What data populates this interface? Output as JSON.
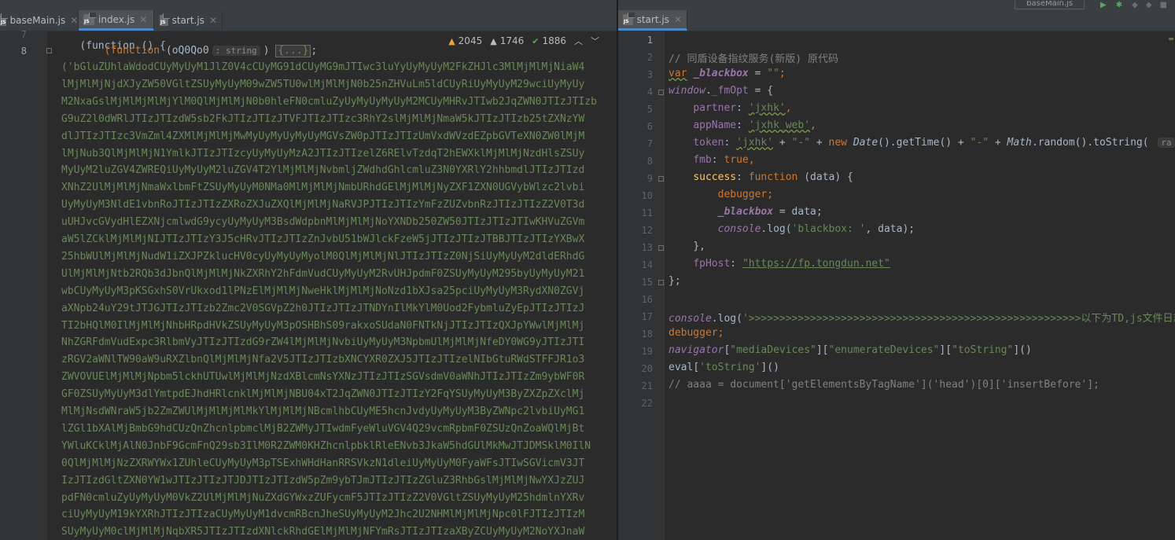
{
  "left_tabs": [
    {
      "label": "baseMain.js"
    },
    {
      "label": "index.js"
    },
    {
      "label": "start.js"
    }
  ],
  "right_tabs": [
    {
      "label": "start.js"
    }
  ],
  "toolbar": {
    "run_config": "baseMain.js"
  },
  "problems": {
    "errors": "2045",
    "warnings": "1746",
    "ok": "1886"
  },
  "left_editor": {
    "line_numbers": [
      "7",
      "8"
    ],
    "line7": "(function () {",
    "line8_keyword": "(function",
    "line8_param": "oQ0Qo0",
    "line8_hint": ": string",
    "line8_close": ")",
    "line8_fold": "{...}",
    "line8_tail": ";",
    "string_lines": [
      "('bGluZUhlaWdodCUyMyUyM1JlZ0V4cCUyMG91dCUyMG9mJTIwc3luYyUyMyUyM2FkZHJlc3MlMjMlMjNiaW4",
      "lMjMlMjNjdXJyZW50VGltZSUyMyUyM09wZW5TU0wlMjMlMjN0b25nZHVuLm5ldCUyRiUyMyUyM29wciUyMyUy",
      "M2NxaGslMjMlMjMlMjYlM0QlMjMlMjN0b0hleFN0cmluZyUyMyUyMyUyM2MCUyMHRvJTIwb2JqZWN0JTIzJTIzb",
      "G9uZ2l0dWRlJTIzJTIzdW5sb2FkJTIzJTIzJTVFJTIzJTIzc3RhY2slMjMlMjNmaW5kJTIzJTIzb25tZXNzYW",
      "dlJTIzJTIzc3VmZml4ZXMlMjMlMjMwMyUyMyUyMyUyMGVsZW0pJTIzJTIzUmVxdWVzdEZpbGVTeXN0ZW0lMjM",
      "lMjNub3QlMjMlMjN1YmlkJTIzJTIzcyUyMyUyMzA2JTIzJTIzelZ6RElvTzdqT2hEWXklMjMlMjNzdHlsZSUy",
      "MyUyM2luZGV4ZWREQiUyMyUyM2luZGV4T2YlMjMlMjNvbmljZWdhdGhlcmluZ3N0YXRlY2hhbmdlJTIzJTIzd",
      "XNhZ2UlMjMlMjNmaWxlbmFtZSUyMyUyM0NMa0MlMjMlMjNmbURhdGElMjMlMjNyZXF1ZXN0UGVybWlzc2lvbi",
      "UyMyUyM3NldE1vbnRoJTIzJTIzZXRoZXJuZXQlMjMlMjNaRVJPJTIzJTIzYmFzZUZvbnRzJTIzJTIzZ2V0T3d",
      "uUHJvcGVydHlEZXNjcmlwdG9ycyUyMyUyM3BsdWdpbnMlMjMlMjNoYXNDb250ZW50JTIzJTIzJTIwKHVuZGVm",
      "aW5lZCklMjMlMjNIJTIzJTIzY3J5cHRvJTIzJTIzZnJvbU51bWJlckFzeW5jJTIzJTIzJTBBJTIzJTIzYXBwX",
      "25hbWUlMjMlMjNudW1iZXJPZklucHV0cyUyMyUyMyolM0QlMjMlMjNlJTIzJTIzZ0NjSiUyMyUyM2dldERhdG",
      "UlMjMlMjNtb2RQb3dJbnQlMjMlMjNkZXRhY2hFdmVudCUyMyUyM2RvUHJpdmF0ZSUyMyUyM295byUyMyUyM21",
      "wbCUyMyUyM3pKSGxhS0VrUkxod1lPNzElMjMlMjNweHklMjMlMjNoNzd1bXJsa25pciUyMyUyM3RydXN0ZGVj",
      "aXNpb24uY29tJTJGJTIzJTIzb2Zmc2V0SGVpZ2h0JTIzJTIzJTNDYnIlMkYlM0Uod2FybmluZyEpJTIzJTIzJ",
      "TI2bHQlM0IlMjMlMjNhbHRpdHVkZSUyMyUyM3pOSHBhS09rakxoSUdaN0FNTkNjJTIzJTIzQXJpYWwlMjMlMj",
      "NhZGRFdmVudExpc3RlbmVyJTIzJTIzdG9rZW4lMjMlMjNvbiUyMyUyM3NpbmUlMjMlMjNfeDY0WG9yJTIzJTI",
      "zRGV2aWNlTW90aW9uRXZlbnQlMjMlMjNfa2V5JTIzJTIzbXNCYXR0ZXJ5JTIzJTIzelNIbGtuRWdSTFFJR1o3",
      "ZWVOVUElMjMlMjNpbm5lckhUTUwlMjMlMjNzdXBlcmNsYXNzJTIzJTIzSGVsdmV0aWNhJTIzJTIzZm9ybWF0R",
      "GF0ZSUyMyUyM3dlYmtpdEJhdHRlcnklMjMlMjNBU04xT2JqZWN0JTIzJTIzY2FqYSUyMyUyM3ByZXZpZXclMj",
      "MlMjNsdWNraW5jb2ZmZWUlMjMlMjMlMkYlMjMlMjNBcmlhbCUyME5hcnJvdyUyMyUyM3ByZWNpc2lvbiUyMG1",
      "lZGl1bXAlMjBmbG9hdCUzQnZhcnlpbmclMjB2ZWMyJTIwdmFyeWluVGV4Q29vcmRpbmF0ZSUzQnZoaWQlMjBt",
      "YWluKCklMjAlN0JnbF9GcmFnQ29sb3IlM0R2ZWM0KHZhcnlpbklRleENvb3JkaW5hdGUlMkMwJTJDMSklM0IlN",
      "0QlMjMlMjNzZXRWYWx1ZUhleCUyMyUyM3pTSExhWHdHanRRSVkzN1dleiUyMyUyM0FyaWFsJTIwSGVicmV3JT",
      "IzJTIzdGltZXN0YW1wJTIzJTIzJTJDJTIzJTIzdW5pZm9ybTJmJTIzJTIzZGluZ3RhbGslMjMlMjNwYXJzZUJ",
      "pdFN0cmluZyUyMyUyM0VkZ2UlMjMlMjNuZXdGYWxzZUFycmF5JTIzJTIzZ2V0VGltZSUyMyUyM25hdmlnYXRv",
      "ciUyMyUyM19kYXRhJTIzJTIzaCUyMyUyM1dvcmRBcnJheSUyMyUyM2Jhc2U2NHMlMjMlMjNpc0lFJTIzJTIzM",
      "SUyMyUyM0clMjMlMjNqbXR5JTIzJTIzdXNlckRhdGElMjMlMjNFYmRsJTIzJTIzaXByZCUyMyUyM2NoYXJnaW"
    ]
  },
  "right_editor": {
    "line_numbers": [
      "1",
      "2",
      "3",
      "4",
      "5",
      "6",
      "7",
      "8",
      "9",
      "10",
      "11",
      "12",
      "13",
      "14",
      "15",
      "16",
      "17",
      "18",
      "19",
      "20",
      "21",
      "22"
    ],
    "l2_comment": "// 同盾设备指纹服务(新版) 原代码",
    "l3_var": "var",
    "l3_name": "_blackbox",
    "l3_eq": " = ",
    "l3_val": "\"\"",
    "l3_semi": ";",
    "l4_window": "window",
    "l4_prop": "_fmOpt",
    "l4_rest": " = {",
    "l5_key": "partner",
    "l5_val": "'jxhk'",
    "l6_key": "appName",
    "l6_val": "'jxhk_web'",
    "l7_key": "token",
    "l7_val1": "'jxhk'",
    "l7_dash1": "\"-\"",
    "l7_new": "new",
    "l7_date": "Date",
    "l7_gettime": "getTime",
    "l7_dash2": "\"-\"",
    "l7_math": "Math",
    "l7_random": "random",
    "l7_tostring": "toString",
    "l7_hint": "ra",
    "l8_key": "fmb",
    "l8_val": "true",
    "l9_key": "success",
    "l9_function": "function",
    "l9_param": " (data) {",
    "l10_debugger": "debugger",
    "l11_name": "_blackbox",
    "l11_rest": " = data;",
    "l12_console": "console",
    "l12_log": "log",
    "l12_str": "'blackbox: '",
    "l12_rest": ", data);",
    "l13": "},",
    "l14_key": "fpHost",
    "l14_url": "\"https://fp.tongdun.net\"",
    "l15": "};",
    "l17_console": "console",
    "l17_log": "log",
    "l17_str": "'>>>>>>>>>>>>>>>>>>>>>>>>>>>>>>>>>>>>>>>>>>>>>>>>>>>>>>以下为TD,js文件日志<<<",
    "l18_debugger": "debugger",
    "l19_nav": "navigator",
    "l19_s1": "\"mediaDevices\"",
    "l19_s2": "\"enumerateDevices\"",
    "l19_s3": "\"toString\"",
    "l20_eval": "eval",
    "l20_s": "'toString'",
    "l21_comment": "// aaaa = document['getElementsByTagName']('head')[0]['insertBefore'];"
  }
}
